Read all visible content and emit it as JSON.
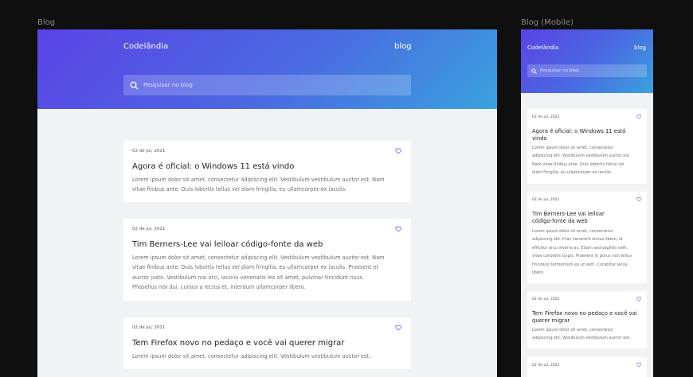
{
  "frames": {
    "desktop_label": "Blog",
    "mobile_label": "Blog (Mobile)"
  },
  "header": {
    "brand": "Codelândia",
    "nav_link": "blog",
    "search_placeholder": "Pesquisar no blog"
  },
  "colors": {
    "gradient_start": "#5a43e6",
    "gradient_end": "#3aa2de",
    "heart": "#6f5cf0",
    "page_bg": "#f1f2f4"
  },
  "desktop_posts": [
    {
      "date": "02 de jul, 2021",
      "title": "Agora é oficial: o Windows 11 está vindo",
      "lines": [
        "Lorem ipsum dolor sit amet, consectetur adipiscing elit. Vestibulum vestibulum auctor est. Nam",
        "vitae finibus ante. Duis lobortis tellus vel diam fringilla, eu ullamcorper ex iaculis."
      ]
    },
    {
      "date": "02 de jul, 2021",
      "title": "Tim Berners-Lee vai leiloar código-fonte da web",
      "lines": [
        "Lorem ipsum dolor sit amet, consectetur adipiscing elit. Vestibulum vestibulum auctor est. Nam",
        "vitae finibus ante. Duis lobortis tellus vel diam fringilla, eu ullamcorper ex iaculis. Praesent et",
        "auctor justo. Vestibulum nisi orci, lacinia venenatis leo sit amet, pulvinar tincidunt risus.",
        "Phasellus nisl dui, cursus a lectus et, interdum ullamcorper libero."
      ]
    },
    {
      "date": "02 de jul, 2021",
      "title": "Tem Firefox novo no pedaço e você vai querer migrar",
      "lines": [
        "Lorem ipsum dolor sit amet, consectetur adipiscing elit. Vestibulum vestibulum auctor est."
      ]
    }
  ],
  "mobile_posts": [
    {
      "date": "02 de jul, 2021",
      "title_lines": [
        "Agora é oficial: o Windows 11 está",
        "vindo"
      ],
      "lines": [
        "Lorem ipsum dolor sit amet, consectetur",
        "adipiscing elit. Vestibulum vestibulum auctor est.",
        "Nam vitae finibus ante. Duis lobortis tellus vel",
        "diam fringilla, eu ullamcorper ex iaculis."
      ]
    },
    {
      "date": "02 de jul, 2021",
      "title_lines": [
        "Tim Berners-Lee vai leiloar",
        "código-fonte da web"
      ],
      "lines": [
        "Lorem ipsum dolor sit amet, consectetur",
        "adipiscing elit. Cras hendrerit lectus libero, id",
        "efficitur arcu viverra ac. Etiam sed sagittis velit,",
        "vitae convallis turpis. Praesent in purus non tellus",
        "tincidunt fermentum eu ut sem. Curabitur lacus",
        "libero."
      ]
    },
    {
      "date": "02 de jul, 2021",
      "title_lines": [
        "Tem Firefox novo no pedaço e você vai",
        "querer migrar"
      ],
      "lines": [
        "Lorem ipsum dolor sit amet, consectetur",
        "adipiscing elit. Vestibulum vestibulum auctor est."
      ]
    },
    {
      "date": "02 de jul, 2021",
      "title_lines": [],
      "lines": []
    }
  ]
}
